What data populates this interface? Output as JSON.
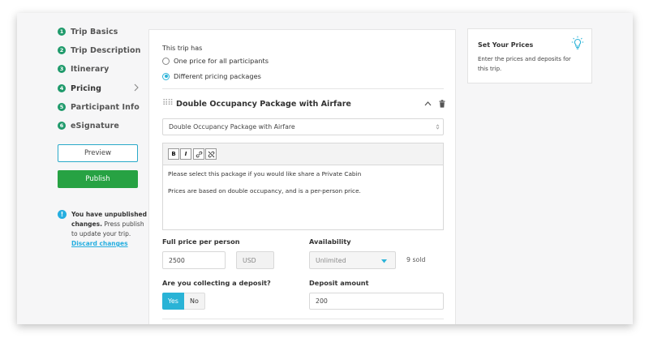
{
  "sidebar": {
    "items": [
      {
        "num": "1",
        "label": "Trip Basics"
      },
      {
        "num": "2",
        "label": "Trip Description"
      },
      {
        "num": "3",
        "label": "Itinerary"
      },
      {
        "num": "4",
        "label": "Pricing"
      },
      {
        "num": "5",
        "label": "Participant Info"
      },
      {
        "num": "6",
        "label": "eSignature"
      }
    ],
    "active_item": "Pricing",
    "preview_label": "Preview",
    "publish_label": "Publish",
    "unpublished": {
      "strong": "You have unpublished changes.",
      "text": " Press publish to update your trip.",
      "discard_label": "Discard changes"
    }
  },
  "pricing": {
    "section_title": "This trip has",
    "option_one": "One price for all participants",
    "option_two": "Different pricing packages",
    "selected_option": "Different pricing packages",
    "package_heading": "Double Occupancy Package with Airfare",
    "package_name_value": "Double Occupancy Package with Airfare",
    "editor": {
      "bold": "B",
      "italic": "I",
      "line1": "Please select this package if you would like share a Private Cabin",
      "line2": "Prices are based on double occupancy, and is a per-person price."
    },
    "full_price_label": "Full price per person",
    "full_price_value": "2500",
    "currency": "USD",
    "availability_label": "Availability",
    "availability_value": "Unlimited",
    "sold_text": "9 sold",
    "deposit_question": "Are you collecting a deposit?",
    "deposit_yes": "Yes",
    "deposit_no": "No",
    "deposit_selected": "Yes",
    "deposit_amount_label": "Deposit amount",
    "deposit_amount_value": "200"
  },
  "help_card": {
    "title": "Set Your Prices",
    "text": "Enter the prices and deposits for this trip."
  },
  "colors": {
    "accent": "#2bb3d8",
    "publish": "#27a243",
    "step_badge": "#1f9a6b"
  }
}
